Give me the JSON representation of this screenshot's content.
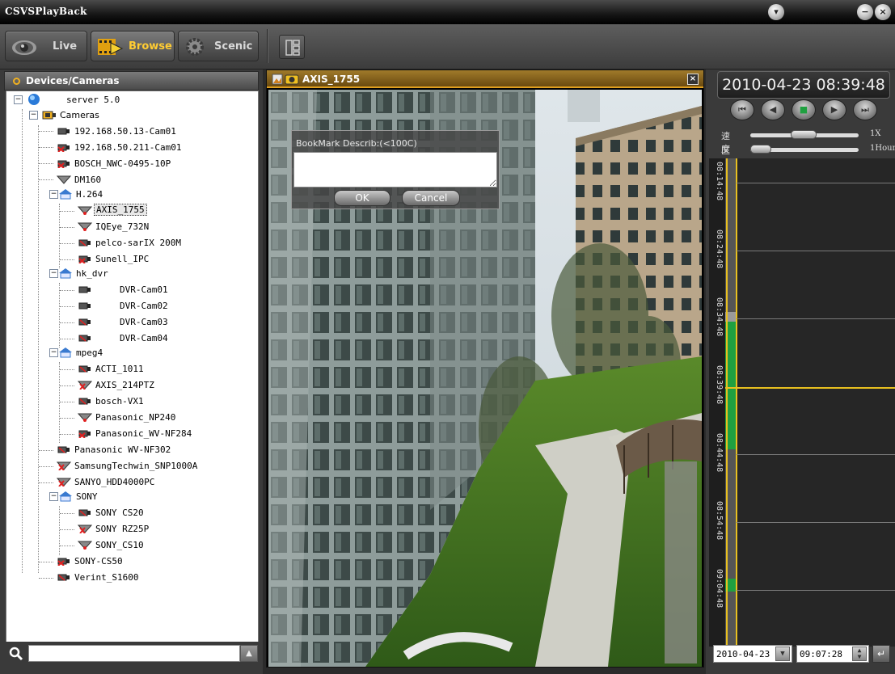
{
  "window": {
    "title": "CSVSPlayBack"
  },
  "tabs": [
    {
      "label": "Live"
    },
    {
      "label": "Browse"
    },
    {
      "label": "Scenic"
    }
  ],
  "devices": {
    "header": "Devices/Cameras",
    "tree": [
      {
        "label": "server 5.0"
      },
      {
        "label": "Cameras"
      },
      {
        "label": "192.168.50.13-Cam01"
      },
      {
        "label": "192.168.50.211-Cam01"
      },
      {
        "label": "BOSCH_NWC-0495-10P"
      },
      {
        "label": "DM160"
      },
      {
        "label": "H.264"
      },
      {
        "label": "AXIS_1755"
      },
      {
        "label": "IQEye_732N"
      },
      {
        "label": "pelco-sarIX 200M"
      },
      {
        "label": "Sunell_IPC"
      },
      {
        "label": "hk_dvr"
      },
      {
        "label": "DVR-Cam01"
      },
      {
        "label": "DVR-Cam02"
      },
      {
        "label": "DVR-Cam03"
      },
      {
        "label": "DVR-Cam04"
      },
      {
        "label": "mpeg4"
      },
      {
        "label": "ACTI_1011"
      },
      {
        "label": "AXIS_214PTZ"
      },
      {
        "label": "bosch-VX1"
      },
      {
        "label": "Panasonic_NP240"
      },
      {
        "label": "Panasonic_WV-NF284"
      },
      {
        "label": "Panasonic WV-NF302"
      },
      {
        "label": "SamsungTechwin_SNP1000A"
      },
      {
        "label": "SANYO_HDD4000PC"
      },
      {
        "label": "SONY"
      },
      {
        "label": "SONY CS20"
      },
      {
        "label": "SONY RZ25P"
      },
      {
        "label": "SONY_CS10"
      },
      {
        "label": "SONY-CS50"
      },
      {
        "label": "Verint_S1600"
      }
    ],
    "search_value": ""
  },
  "video": {
    "title": "AXIS_1755",
    "close_glyph": "×",
    "bookmark": {
      "caption": "BookMark Describ:(<100C)",
      "value": "",
      "ok_label": "OK",
      "cancel_label": "Cancel"
    }
  },
  "playback": {
    "datetime": "2010-04-23 08:39:48",
    "speed": {
      "label": "速度",
      "value": "1X"
    },
    "interval": {
      "label": "区间",
      "value": "1Hour"
    },
    "timeline_labels": [
      "08:14:48",
      "08:24:48",
      "08:34:48",
      "08:39:48",
      "08:44:48",
      "08:54:48",
      "09:04:48"
    ],
    "date_value": "2010-04-23",
    "time_value": "09:07:28"
  },
  "colors": {
    "accent": "#ffcc33",
    "recording": "#1fa040",
    "cursor": "#e8c020"
  }
}
